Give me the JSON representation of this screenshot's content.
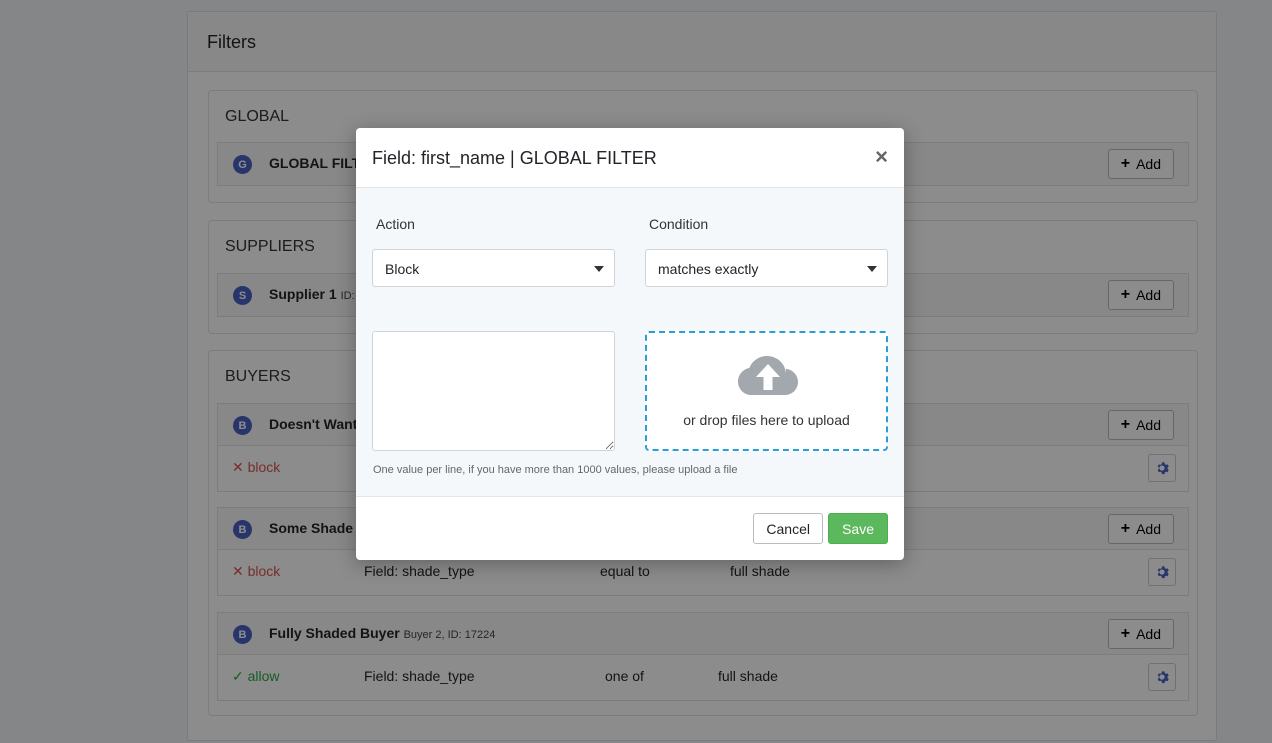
{
  "page": {
    "title": "Filters",
    "sections": {
      "global": {
        "title": "GLOBAL",
        "row": {
          "badge": "G",
          "name": "GLOBAL FILTER",
          "add_label": "Add"
        }
      },
      "suppliers": {
        "title": "SUPPLIERS",
        "row": {
          "badge": "S",
          "name": "Supplier 1",
          "sub": "ID:",
          "add_label": "Add"
        }
      },
      "buyers": {
        "title": "BUYERS",
        "rows": [
          {
            "badge": "B",
            "name": "Doesn't Want",
            "add_label": "Add",
            "rule": {
              "action_icon": "✕",
              "action": "block"
            }
          },
          {
            "badge": "B",
            "name": "Some Shade",
            "add_label": "Add",
            "rule": {
              "action_icon": "✕",
              "action": "block",
              "field": "Field: shade_type",
              "condition": "equal to",
              "value": "full shade"
            }
          },
          {
            "badge": "B",
            "name": "Fully Shaded Buyer",
            "sub": "Buyer 2, ID: 17224",
            "add_label": "Add",
            "rule": {
              "action_icon": "✓",
              "action": "allow",
              "field": "Field: shade_type",
              "condition": "one of",
              "value": "full shade"
            }
          }
        ]
      }
    }
  },
  "modal": {
    "title": "Field: first_name | GLOBAL FILTER",
    "close": "×",
    "action_label": "Action",
    "action_value": "Block",
    "condition_label": "Condition",
    "condition_value": "matches exactly",
    "values_text": "",
    "dropzone_text": "or drop files here to upload",
    "help_text": "One value per line, if you have more than 1000 values, please upload a file",
    "cancel_label": "Cancel",
    "save_label": "Save"
  },
  "colors": {
    "badge": "#4a62c4",
    "block": "#d9534f",
    "allow": "#28a745",
    "save": "#5cb85c",
    "dropzone_border": "#2a9fd6"
  }
}
